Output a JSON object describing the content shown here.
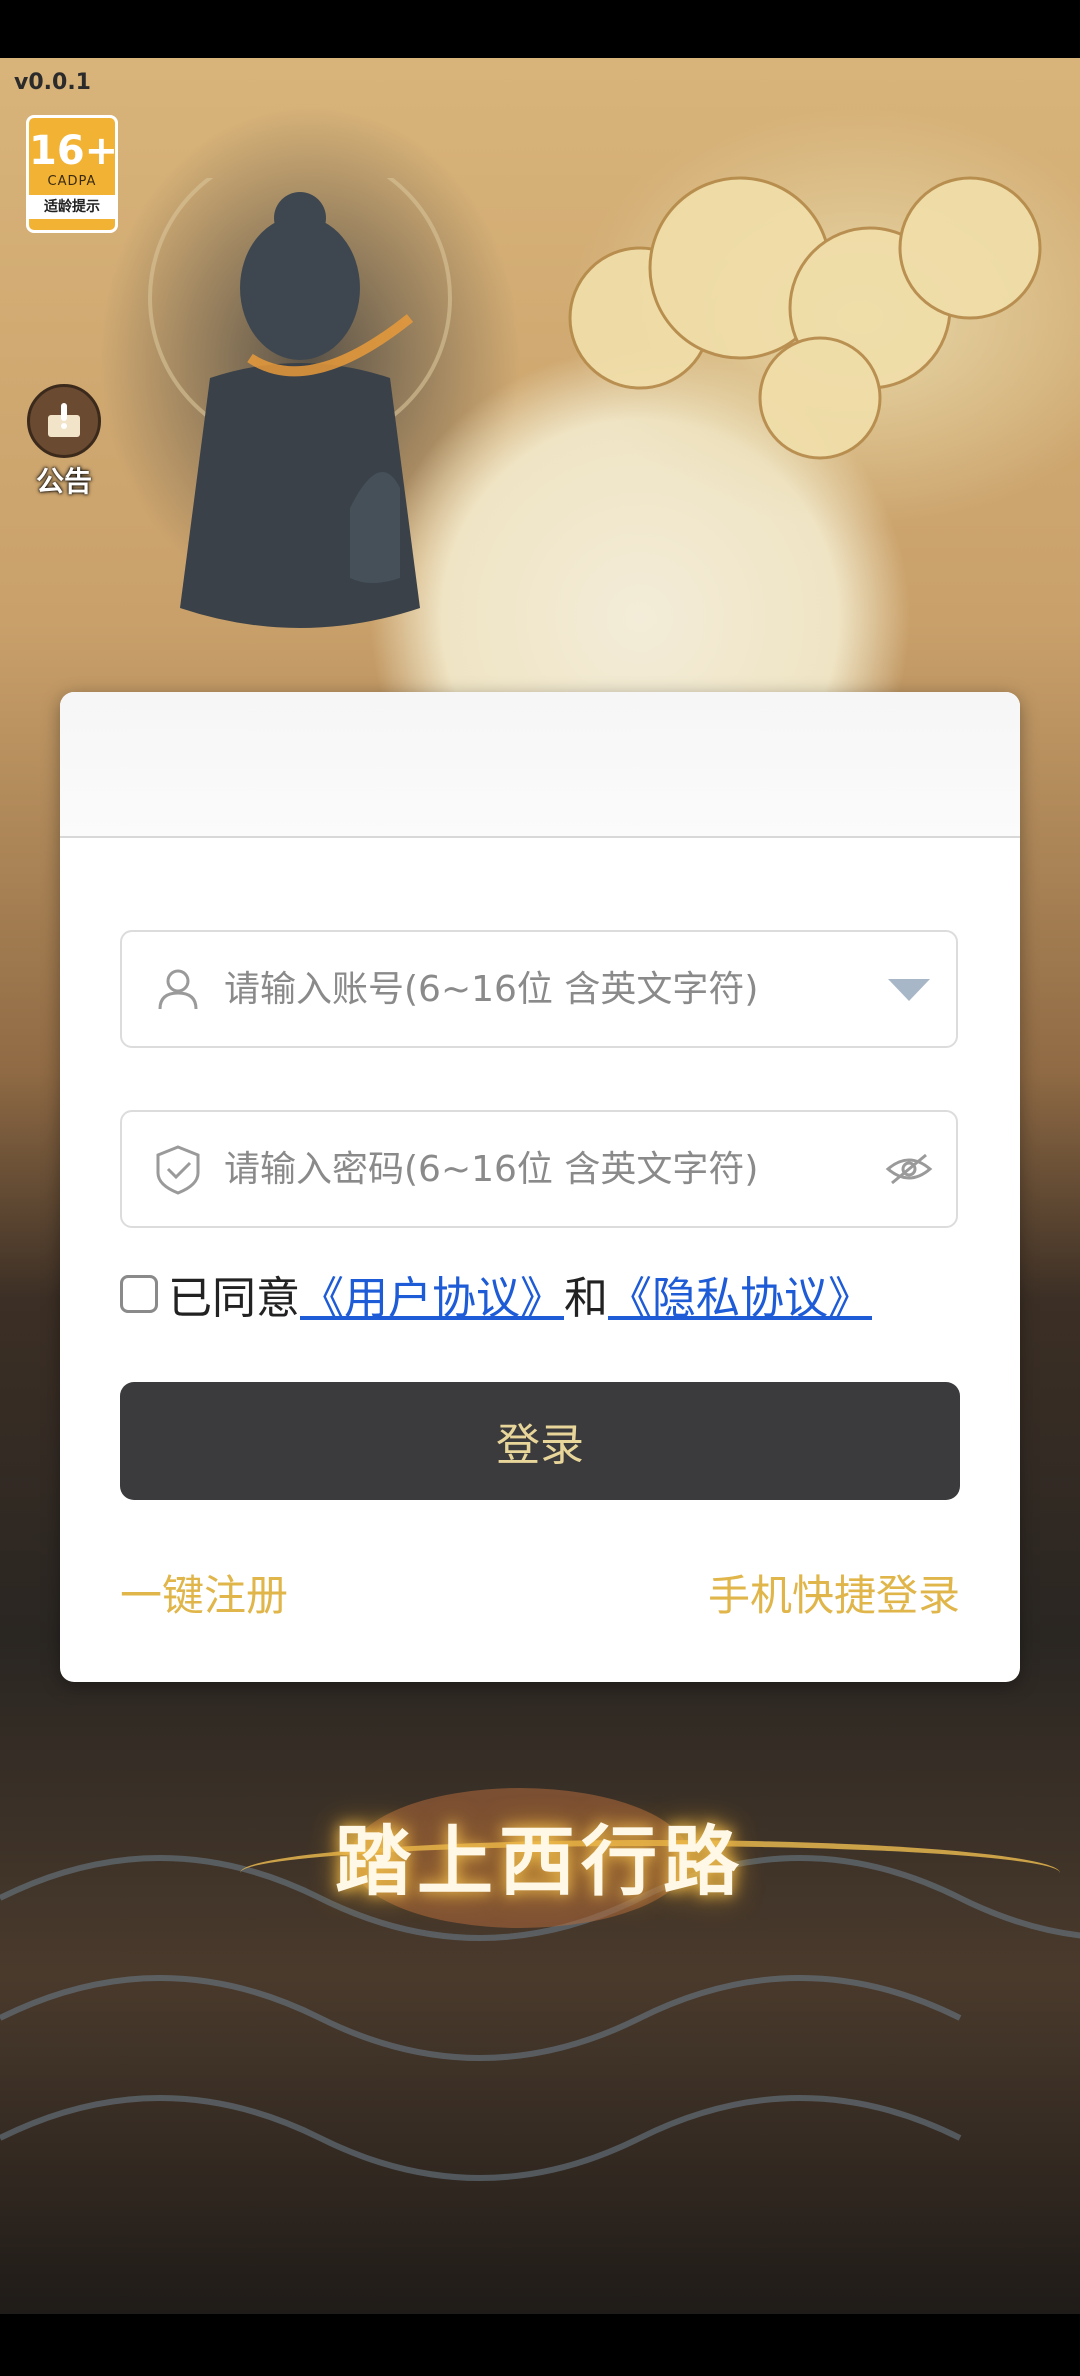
{
  "app": {
    "version": "v0.0.1",
    "age_rating": {
      "number": "16+",
      "org": "CADPA",
      "tip": "适龄提示"
    },
    "notice_label": "公告",
    "slogan": "踏上西行路"
  },
  "login": {
    "account_placeholder": "请输入账号(6~16位 含英文字符)",
    "password_placeholder": "请输入密码(6~16位 含英文字符)",
    "agree_text": "已同意",
    "user_agreement": "《用户协议》",
    "and_text": "和",
    "privacy_agreement": "《隐私协议》",
    "login_button": "登录",
    "register_link": "一键注册",
    "phone_login_link": "手机快捷登录"
  },
  "colors": {
    "link": "#1e5bd6",
    "accent_gold": "#e0b54a",
    "button_bg": "#3b3b3d"
  },
  "icons": [
    "user-icon",
    "shield-icon",
    "dropdown-arrow-icon",
    "eye-hidden-icon",
    "notice-icon"
  ]
}
